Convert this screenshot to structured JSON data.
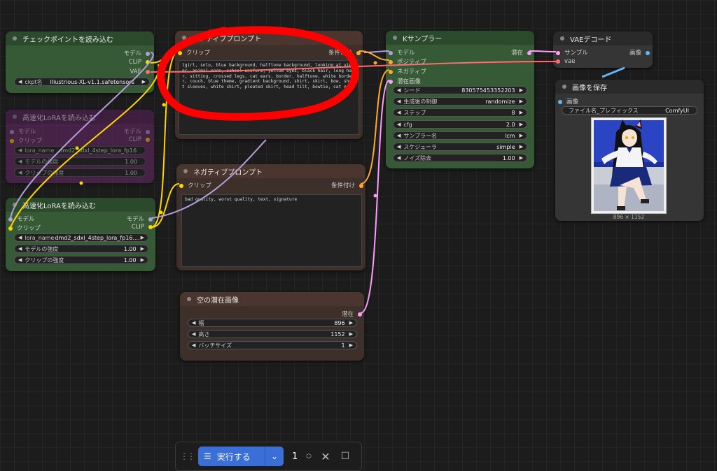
{
  "colors": {
    "model": "#b39ddb",
    "clip": "#ffd500",
    "vae": "#ff6e6e",
    "conditioning": "#ffa931",
    "latent": "#ff9cf9",
    "image": "#64b5f6",
    "annotation": "#ff0000",
    "run": "#3a6fd8"
  },
  "checkpoint": {
    "title": "チェックポイントを読み込む",
    "out_model": "モデル",
    "out_clip": "CLIP",
    "out_vae": "VAE",
    "ckpt_label": "ckpt名",
    "ckpt_value": "Illustrious-XL-v1.1.safetensors"
  },
  "lora_ghost": {
    "title": "高速化LoRAを読み込む",
    "in_model": "モデル",
    "in_clip": "クリップ",
    "out_model": "モデル",
    "out_clip": "CLIP",
    "lora_label": "lora_name",
    "lora_value": "dmd2_sdxl_4step_lora_fp16",
    "model_strength_label": "モデルの強度",
    "model_strength_value": "1.00",
    "clip_strength_label": "クリップの強度",
    "clip_strength_value": "1.00"
  },
  "lora": {
    "title": "高速化LoRAを読み込む",
    "in_model": "モデル",
    "in_clip": "クリップ",
    "out_model": "モデル",
    "out_clip": "CLIP",
    "lora_label": "lora_name",
    "lora_value": "dmd2_sdxl_4step_lora_fp16....",
    "model_strength_label": "モデルの強度",
    "model_strength_value": "1.00",
    "clip_strength_label": "クリップの強度",
    "clip_strength_value": "1.00"
  },
  "positive": {
    "title": "ポジティブプロンプト",
    "in_clip": "クリップ",
    "out_cond": "条件付け",
    "text": "1girl, solo, blue background, halftone background, looking at viewer, animal ears, school uniform, yellow eyes, black hair, long hair, sitting, crossed legs, cat ears, border, halftone, white border, couch, blue theme, gradient background, shirt, skirt, bow, short sleeves, white shirt, pleated skirt, head tilt, bowtie, cat girl"
  },
  "negative": {
    "title": "ネガティブプロンプト",
    "in_clip": "クリップ",
    "out_cond": "条件付け",
    "text": "bad quality, worst quality, text, signature"
  },
  "latent": {
    "title": "空の潜在画像",
    "out_latent": "潜在",
    "width_label": "幅",
    "width_value": "896",
    "height_label": "高さ",
    "height_value": "1152",
    "batch_label": "バッチサイズ",
    "batch_value": "1"
  },
  "ksampler": {
    "title": "Kサンプラー",
    "in_model": "モデル",
    "in_positive": "ポジティブ",
    "in_negative": "ネガティブ",
    "in_latent": "潜在画像",
    "out_latent": "潜在",
    "seed_label": "シード",
    "seed_value": "830575453352203",
    "control_label": "生成後の制御",
    "control_value": "randomize",
    "steps_label": "ステップ",
    "steps_value": "8",
    "cfg_label": "cfg",
    "cfg_value": "2.0",
    "sampler_label": "サンプラー名",
    "sampler_value": "lcm",
    "scheduler_label": "スケジューラ",
    "scheduler_value": "simple",
    "denoise_label": "ノイズ除去",
    "denoise_value": "1.00"
  },
  "vae_decode": {
    "title": "VAEデコード",
    "in_samples": "サンプル",
    "in_vae": "vae",
    "out_image": "画像"
  },
  "save_image": {
    "title": "画像を保存",
    "in_image": "画像",
    "prefix_label": "ファイル名_プレフィックス",
    "prefix_value": "ComfyUI",
    "image_size": "896 × 1152"
  },
  "toolbar": {
    "run_label": "実行する",
    "batch_count": "1",
    "grip_icon": "drag-handle-icon",
    "queue_icon": "queue-icon",
    "cancel_icon": "close-icon",
    "stop_icon": "stop-icon"
  }
}
